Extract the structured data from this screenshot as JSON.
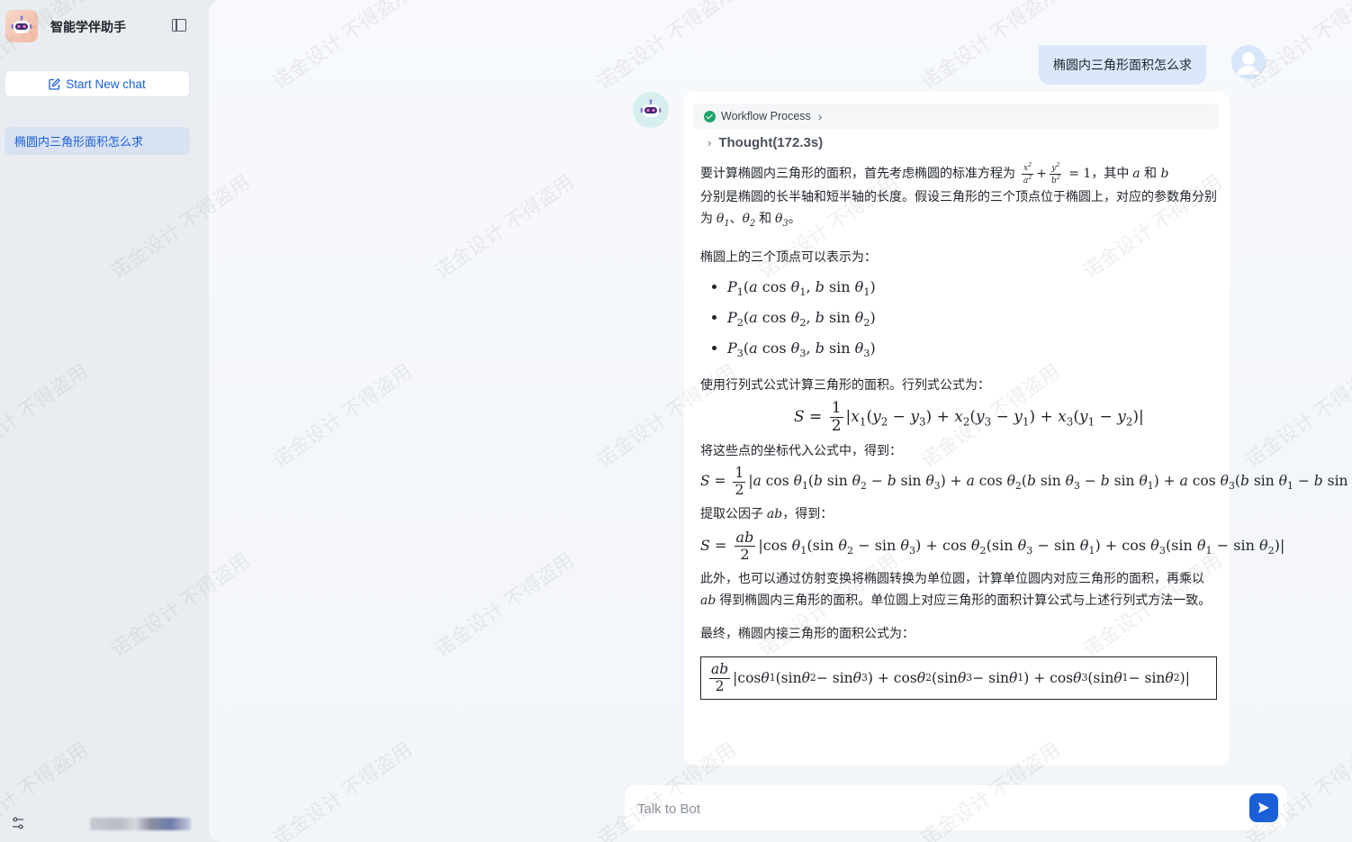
{
  "app": {
    "title": "智能学伴助手"
  },
  "sidebar": {
    "new_chat_label": "Start New chat",
    "chats": [
      {
        "label": "椭圆内三角形面积怎么求"
      }
    ]
  },
  "conversation": {
    "user_message": "椭圆内三角形面积怎么求",
    "workflow_label": "Workflow Process",
    "thought_label": "Thought(172.3s)",
    "answer": {
      "intro_a": "要计算椭圆内三角形的面积，首先考虑椭圆的标准方程为",
      "intro_b": "，其中",
      "and_1": "和",
      "intro_c": "分别是椭圆的长半轴和短半轴的长度。假设三角形的三个顶点位于椭圆上，对应的参数角分别为",
      "sep_1": "、",
      "and_2": "和",
      "period": "。",
      "vertices_intro": "椭圆上的三个顶点可以表示为：",
      "determinant_intro": "使用行列式公式计算三角形的面积。行列式公式为：",
      "substitute_intro": "将这些点的坐标代入公式中，得到：",
      "factor_intro_a": "提取公因子",
      "factor_intro_b": "，得到：",
      "affine_a": "此外，也可以通过仿射变换将椭圆转换为单位圆，计算单位圆内对应三角形的面积，再乘以",
      "affine_b": "得到椭圆内三角形的面积。单位圆上对应三角形的面积计算公式与上述行列式方法一致。",
      "final_intro": "最终，椭圆内接三角形的面积公式为："
    }
  },
  "input": {
    "placeholder": "Talk to Bot"
  },
  "watermark": {
    "text": "诺金设计  不得盗用"
  },
  "colors": {
    "accent": "#1a5fd8",
    "success": "#20a46b",
    "user_bubble": "#dbe8fb",
    "sidebar_bg": "#e9ecf1",
    "selected_chat_bg": "#d9e2f3"
  },
  "icons": {
    "collapse": "sidebar-collapse-icon",
    "new_chat": "edit-icon",
    "workflow_status": "check-circle-icon",
    "send": "send-icon",
    "settings": "sliders-icon"
  }
}
